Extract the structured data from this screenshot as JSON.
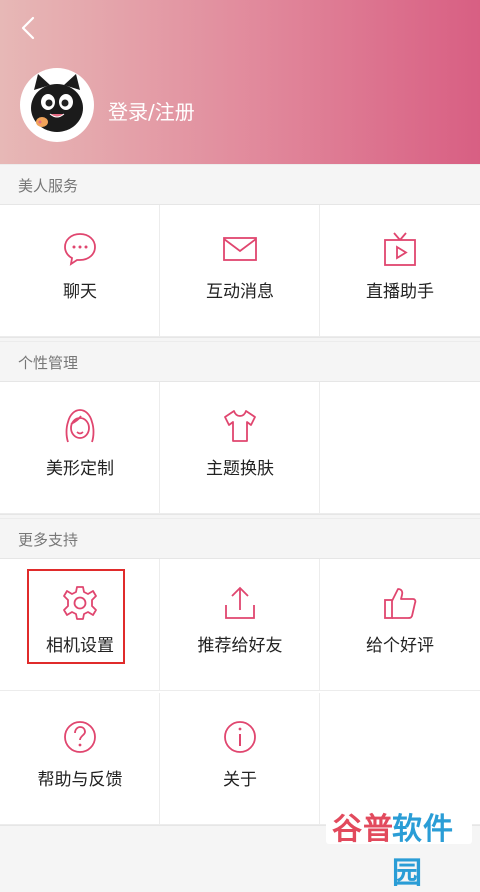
{
  "header": {
    "login_text": "登录/注册",
    "gradient": [
      "#e7b8b6",
      "#d85f83"
    ]
  },
  "sections": [
    {
      "title": "美人服务",
      "items": [
        {
          "label": "聊天",
          "icon": "chat-icon"
        },
        {
          "label": "互动消息",
          "icon": "mail-icon"
        },
        {
          "label": "直播助手",
          "icon": "tv-play-icon"
        }
      ]
    },
    {
      "title": "个性管理",
      "items": [
        {
          "label": "美形定制",
          "icon": "face-icon"
        },
        {
          "label": "主题换肤",
          "icon": "tshirt-icon"
        }
      ]
    },
    {
      "title": "更多支持",
      "items": [
        {
          "label": "相机设置",
          "icon": "gear-icon"
        },
        {
          "label": "推荐给好友",
          "icon": "share-upload-icon"
        },
        {
          "label": "给个好评",
          "icon": "thumbs-up-icon"
        },
        {
          "label": "帮助与反馈",
          "icon": "help-icon"
        },
        {
          "label": "关于",
          "icon": "info-icon"
        }
      ]
    }
  ],
  "accent_color": "#e0466f",
  "watermark": {
    "part1": "谷普",
    "part2": "软件园"
  }
}
